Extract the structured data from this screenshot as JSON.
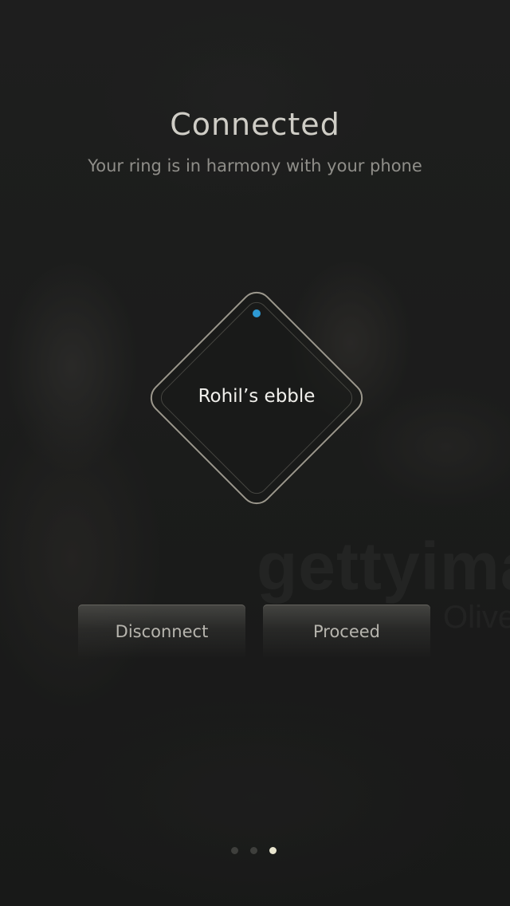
{
  "header": {
    "title": "Connected",
    "subtitle": "Your ring is in harmony with your phone"
  },
  "device": {
    "name": "Rohil’s ebble",
    "status_color": "#2e9ad4",
    "status_icon": "connection-status-dot"
  },
  "watermark": {
    "brand": "gettyimages",
    "credit": "Olive"
  },
  "actions": {
    "disconnect_label": "Disconnect",
    "proceed_label": "Proceed"
  },
  "pager": {
    "total": 3,
    "active_index": 2
  },
  "colors": {
    "accent_blue": "#2e9ad4",
    "title_text": "#cfcdc6",
    "active_dot": "#e9e6cf"
  }
}
